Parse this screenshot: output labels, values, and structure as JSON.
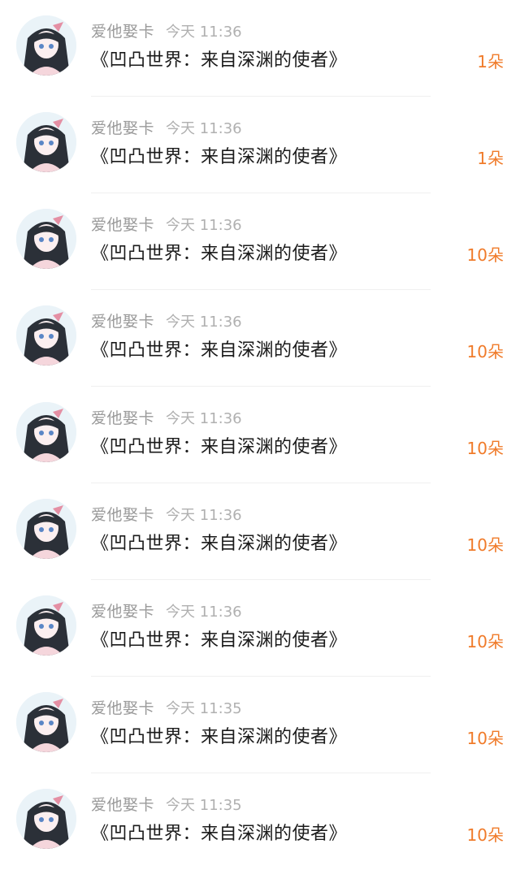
{
  "gift_list": {
    "items": [
      {
        "user": "爱他娶卡",
        "time": "今天 11:36",
        "title": "《凹凸世界：来自深渊的使者》",
        "amount": "1朵",
        "avatar_icon": "anime-girl-avatar-icon"
      },
      {
        "user": "爱他娶卡",
        "time": "今天 11:36",
        "title": "《凹凸世界：来自深渊的使者》",
        "amount": "1朵",
        "avatar_icon": "anime-girl-avatar-icon"
      },
      {
        "user": "爱他娶卡",
        "time": "今天 11:36",
        "title": "《凹凸世界：来自深渊的使者》",
        "amount": "10朵",
        "avatar_icon": "anime-girl-avatar-icon"
      },
      {
        "user": "爱他娶卡",
        "time": "今天 11:36",
        "title": "《凹凸世界：来自深渊的使者》",
        "amount": "10朵",
        "avatar_icon": "anime-girl-avatar-icon"
      },
      {
        "user": "爱他娶卡",
        "time": "今天 11:36",
        "title": "《凹凸世界：来自深渊的使者》",
        "amount": "10朵",
        "avatar_icon": "anime-girl-avatar-icon"
      },
      {
        "user": "爱他娶卡",
        "time": "今天 11:36",
        "title": "《凹凸世界：来自深渊的使者》",
        "amount": "10朵",
        "avatar_icon": "anime-girl-avatar-icon"
      },
      {
        "user": "爱他娶卡",
        "time": "今天 11:36",
        "title": "《凹凸世界：来自深渊的使者》",
        "amount": "10朵",
        "avatar_icon": "anime-girl-avatar-icon"
      },
      {
        "user": "爱他娶卡",
        "time": "今天 11:35",
        "title": "《凹凸世界：来自深渊的使者》",
        "amount": "10朵",
        "avatar_icon": "anime-girl-avatar-icon"
      },
      {
        "user": "爱他娶卡",
        "time": "今天 11:35",
        "title": "《凹凸世界：来自深渊的使者》",
        "amount": "10朵",
        "avatar_icon": "anime-girl-avatar-icon"
      }
    ]
  },
  "colors": {
    "amount": "#f07b2a",
    "user_name": "#9a9a9a",
    "time_stamp": "#b0b0b0",
    "title": "#1a1a1a"
  }
}
